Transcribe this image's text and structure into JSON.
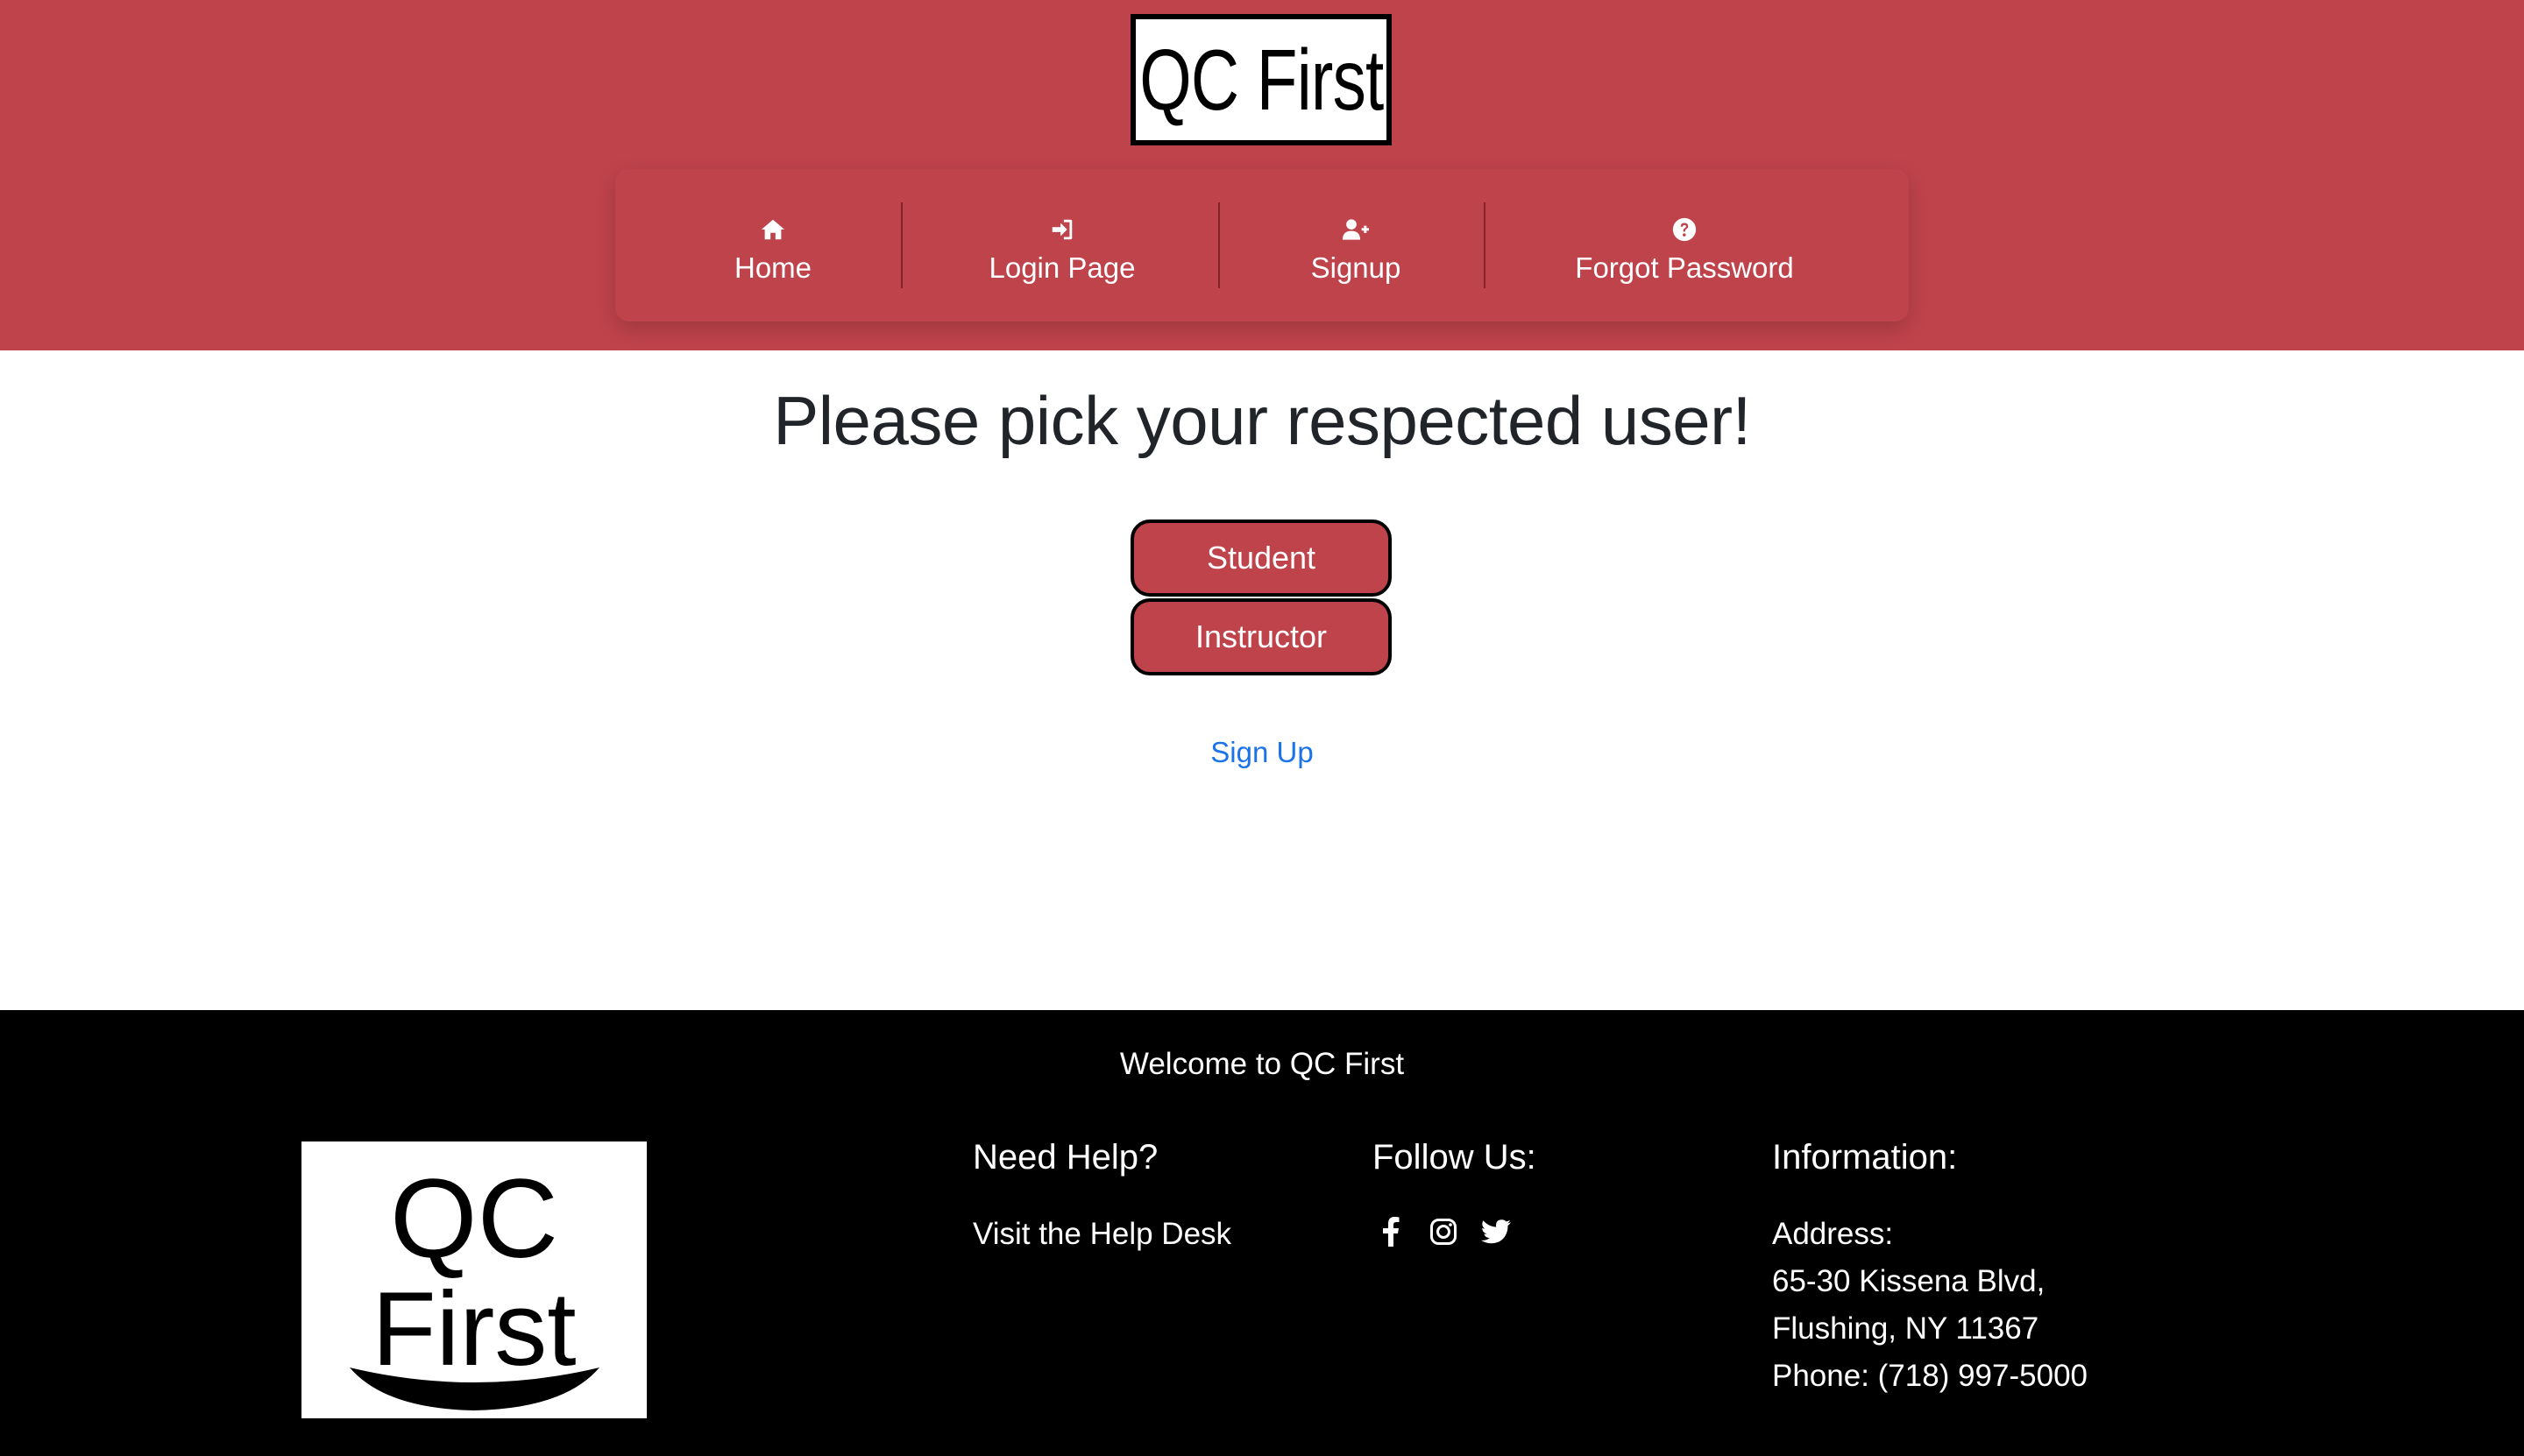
{
  "header": {
    "logo_text": "QC First",
    "nav": [
      {
        "label": "Home",
        "icon": "home-icon"
      },
      {
        "label": "Login Page",
        "icon": "sign-in-icon"
      },
      {
        "label": "Signup",
        "icon": "user-plus-icon"
      },
      {
        "label": "Forgot Password",
        "icon": "question-circle-icon"
      }
    ]
  },
  "main": {
    "title": "Please pick your respected user!",
    "buttons": {
      "student": "Student",
      "instructor": "Instructor"
    },
    "signup_link": "Sign Up"
  },
  "footer": {
    "welcome": "Welcome to QC First",
    "logo_line1": "QC",
    "logo_line2": "First",
    "help": {
      "title": "Need Help?",
      "link": "Visit the Help Desk"
    },
    "follow": {
      "title": "Follow Us:",
      "icons": [
        "facebook-icon",
        "instagram-icon",
        "twitter-icon"
      ]
    },
    "info": {
      "title": "Information:",
      "address_label": "Address:",
      "address_line1": "65-30 Kissena Blvd,",
      "address_line2": "Flushing, NY 11367",
      "phone": "Phone: (718) 997-5000"
    }
  },
  "colors": {
    "brand_red": "#bf434b",
    "link_blue": "#1a73e8",
    "footer_bg": "#000000"
  }
}
